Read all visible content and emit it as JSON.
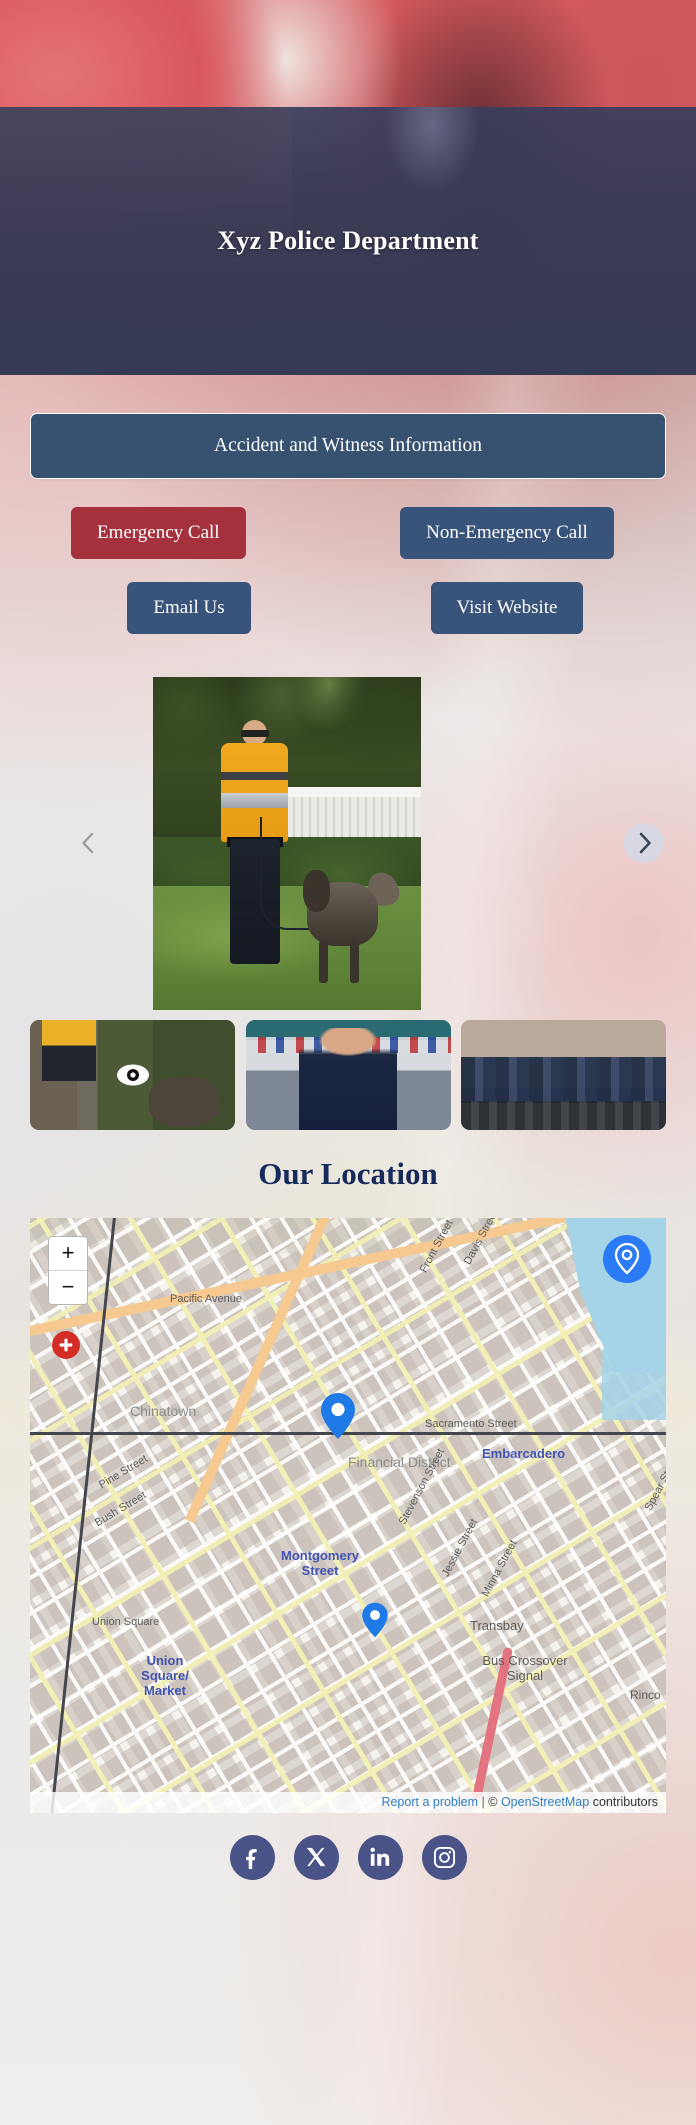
{
  "header": {
    "title": "Xyz Police Department"
  },
  "actions": {
    "wide_button": "Accident and Witness Information",
    "buttons": [
      {
        "label": "Emergency Call",
        "style": "danger"
      },
      {
        "label": "Non-Emergency Call",
        "style": "primary"
      },
      {
        "label": "Email Us",
        "style": "primary"
      },
      {
        "label": "Visit Website",
        "style": "primary"
      }
    ]
  },
  "carousel": {
    "prev_icon": "chevron-left-icon",
    "next_icon": "chevron-right-icon",
    "active_indicator_icon": "eye-icon",
    "slides": [
      {
        "alt": "Officer with K9 police dog on grass"
      },
      {
        "alt": "Police officer in front of patrol cars"
      },
      {
        "alt": "Bicycle police officers in formation"
      }
    ]
  },
  "location": {
    "title": "Our Location",
    "map": {
      "zoom_in_label": "+",
      "zoom_out_label": "−",
      "geolocate_icon": "location-pin-icon",
      "marker_icon": "map-pin-icon",
      "labels": [
        "Chinatown",
        "Financial District",
        "Sacramento Street",
        "Pacific Avenue",
        "Davis Street",
        "Front Street",
        "Pine Street",
        "Bush Street",
        "Montgomery Street",
        "Union Square",
        "Union Square/ Market",
        "Jessie Street",
        "Minna Street",
        "Stevenson Street",
        "Embarcadero",
        "Spear Street",
        "Transbay",
        "Bus Crossover Signal",
        "Rinco"
      ],
      "attribution": {
        "report": "Report a problem",
        "separator": "|",
        "copyright": "©",
        "osm": "OpenStreetMap",
        "contributors": "contributors"
      }
    }
  },
  "footer": {
    "social": [
      {
        "name": "facebook",
        "glyph": "f"
      },
      {
        "name": "x-twitter",
        "glyph": "X"
      },
      {
        "name": "linkedin",
        "glyph": "in"
      },
      {
        "name": "instagram",
        "glyph": "ig"
      }
    ]
  },
  "colors": {
    "primary": "#39547a",
    "danger": "#a5313c",
    "heading": "#172a5c",
    "social_bg": "#4a5387",
    "accent_blue": "#2a7bf5"
  }
}
